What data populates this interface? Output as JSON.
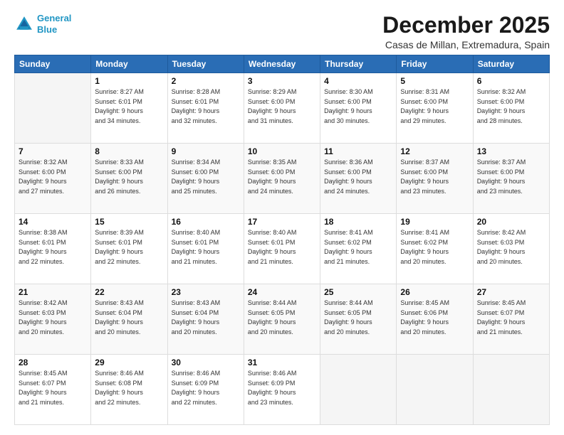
{
  "logo": {
    "line1": "General",
    "line2": "Blue"
  },
  "title": "December 2025",
  "subtitle": "Casas de Millan, Extremadura, Spain",
  "days_header": [
    "Sunday",
    "Monday",
    "Tuesday",
    "Wednesday",
    "Thursday",
    "Friday",
    "Saturday"
  ],
  "weeks": [
    [
      {
        "day": "",
        "info": ""
      },
      {
        "day": "1",
        "info": "Sunrise: 8:27 AM\nSunset: 6:01 PM\nDaylight: 9 hours\nand 34 minutes."
      },
      {
        "day": "2",
        "info": "Sunrise: 8:28 AM\nSunset: 6:01 PM\nDaylight: 9 hours\nand 32 minutes."
      },
      {
        "day": "3",
        "info": "Sunrise: 8:29 AM\nSunset: 6:00 PM\nDaylight: 9 hours\nand 31 minutes."
      },
      {
        "day": "4",
        "info": "Sunrise: 8:30 AM\nSunset: 6:00 PM\nDaylight: 9 hours\nand 30 minutes."
      },
      {
        "day": "5",
        "info": "Sunrise: 8:31 AM\nSunset: 6:00 PM\nDaylight: 9 hours\nand 29 minutes."
      },
      {
        "day": "6",
        "info": "Sunrise: 8:32 AM\nSunset: 6:00 PM\nDaylight: 9 hours\nand 28 minutes."
      }
    ],
    [
      {
        "day": "7",
        "info": "Sunrise: 8:32 AM\nSunset: 6:00 PM\nDaylight: 9 hours\nand 27 minutes."
      },
      {
        "day": "8",
        "info": "Sunrise: 8:33 AM\nSunset: 6:00 PM\nDaylight: 9 hours\nand 26 minutes."
      },
      {
        "day": "9",
        "info": "Sunrise: 8:34 AM\nSunset: 6:00 PM\nDaylight: 9 hours\nand 25 minutes."
      },
      {
        "day": "10",
        "info": "Sunrise: 8:35 AM\nSunset: 6:00 PM\nDaylight: 9 hours\nand 24 minutes."
      },
      {
        "day": "11",
        "info": "Sunrise: 8:36 AM\nSunset: 6:00 PM\nDaylight: 9 hours\nand 24 minutes."
      },
      {
        "day": "12",
        "info": "Sunrise: 8:37 AM\nSunset: 6:00 PM\nDaylight: 9 hours\nand 23 minutes."
      },
      {
        "day": "13",
        "info": "Sunrise: 8:37 AM\nSunset: 6:00 PM\nDaylight: 9 hours\nand 23 minutes."
      }
    ],
    [
      {
        "day": "14",
        "info": "Sunrise: 8:38 AM\nSunset: 6:01 PM\nDaylight: 9 hours\nand 22 minutes."
      },
      {
        "day": "15",
        "info": "Sunrise: 8:39 AM\nSunset: 6:01 PM\nDaylight: 9 hours\nand 22 minutes."
      },
      {
        "day": "16",
        "info": "Sunrise: 8:40 AM\nSunset: 6:01 PM\nDaylight: 9 hours\nand 21 minutes."
      },
      {
        "day": "17",
        "info": "Sunrise: 8:40 AM\nSunset: 6:01 PM\nDaylight: 9 hours\nand 21 minutes."
      },
      {
        "day": "18",
        "info": "Sunrise: 8:41 AM\nSunset: 6:02 PM\nDaylight: 9 hours\nand 21 minutes."
      },
      {
        "day": "19",
        "info": "Sunrise: 8:41 AM\nSunset: 6:02 PM\nDaylight: 9 hours\nand 20 minutes."
      },
      {
        "day": "20",
        "info": "Sunrise: 8:42 AM\nSunset: 6:03 PM\nDaylight: 9 hours\nand 20 minutes."
      }
    ],
    [
      {
        "day": "21",
        "info": "Sunrise: 8:42 AM\nSunset: 6:03 PM\nDaylight: 9 hours\nand 20 minutes."
      },
      {
        "day": "22",
        "info": "Sunrise: 8:43 AM\nSunset: 6:04 PM\nDaylight: 9 hours\nand 20 minutes."
      },
      {
        "day": "23",
        "info": "Sunrise: 8:43 AM\nSunset: 6:04 PM\nDaylight: 9 hours\nand 20 minutes."
      },
      {
        "day": "24",
        "info": "Sunrise: 8:44 AM\nSunset: 6:05 PM\nDaylight: 9 hours\nand 20 minutes."
      },
      {
        "day": "25",
        "info": "Sunrise: 8:44 AM\nSunset: 6:05 PM\nDaylight: 9 hours\nand 20 minutes."
      },
      {
        "day": "26",
        "info": "Sunrise: 8:45 AM\nSunset: 6:06 PM\nDaylight: 9 hours\nand 20 minutes."
      },
      {
        "day": "27",
        "info": "Sunrise: 8:45 AM\nSunset: 6:07 PM\nDaylight: 9 hours\nand 21 minutes."
      }
    ],
    [
      {
        "day": "28",
        "info": "Sunrise: 8:45 AM\nSunset: 6:07 PM\nDaylight: 9 hours\nand 21 minutes."
      },
      {
        "day": "29",
        "info": "Sunrise: 8:46 AM\nSunset: 6:08 PM\nDaylight: 9 hours\nand 22 minutes."
      },
      {
        "day": "30",
        "info": "Sunrise: 8:46 AM\nSunset: 6:09 PM\nDaylight: 9 hours\nand 22 minutes."
      },
      {
        "day": "31",
        "info": "Sunrise: 8:46 AM\nSunset: 6:09 PM\nDaylight: 9 hours\nand 23 minutes."
      },
      {
        "day": "",
        "info": ""
      },
      {
        "day": "",
        "info": ""
      },
      {
        "day": "",
        "info": ""
      }
    ]
  ]
}
